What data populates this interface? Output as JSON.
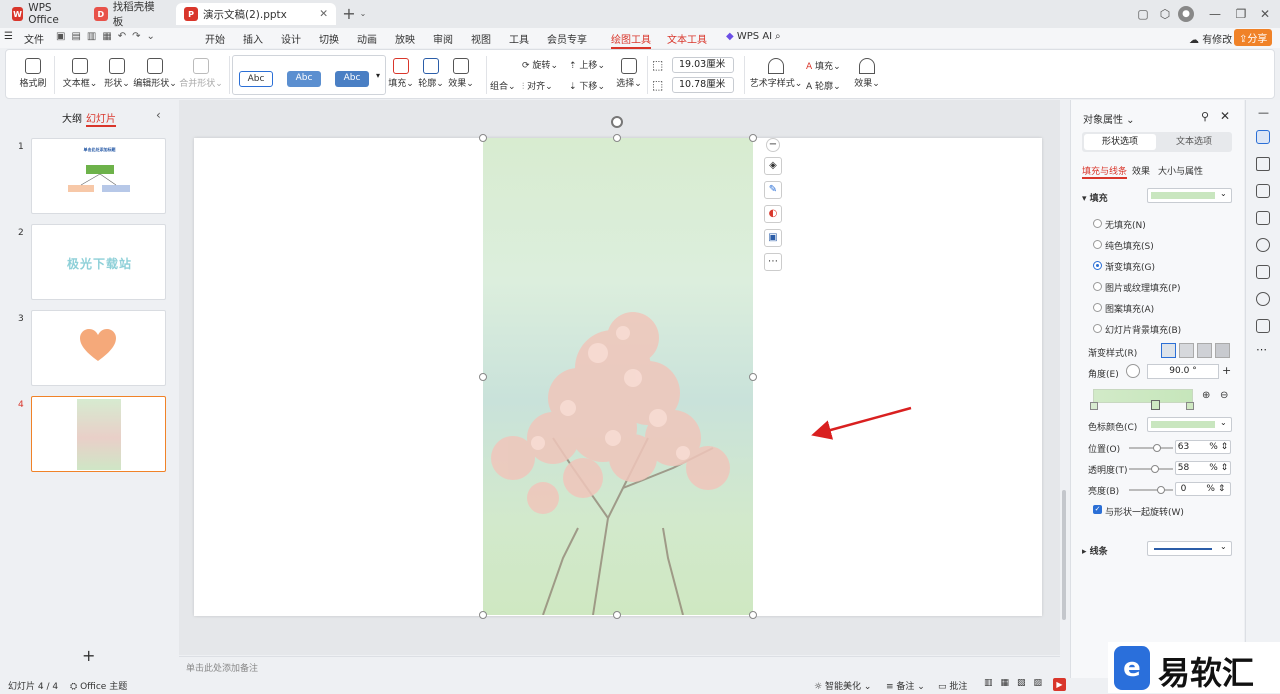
{
  "tabs": [
    {
      "label": "WPS Office",
      "logo": "W"
    },
    {
      "label": "找稻壳模板",
      "logo": "D"
    },
    {
      "label": "演示文稿(2).pptx",
      "logo": "P"
    }
  ],
  "menu": {
    "file": "文件",
    "items": [
      "开始",
      "插入",
      "设计",
      "切换",
      "动画",
      "放映",
      "审阅",
      "视图",
      "工具",
      "会员专享",
      "绘图工具",
      "文本工具",
      "WPS AI"
    ],
    "modified": "有修改",
    "share": "分享"
  },
  "ribbon": {
    "format_brush": "格式刷",
    "textbox": "文本框",
    "shape": "形状",
    "edit_shape": "编辑形状",
    "merge_shape": "合并形状",
    "style_abc": [
      "Abc",
      "Abc",
      "Abc"
    ],
    "fill": "填充",
    "outline": "轮廓",
    "effect": "效果",
    "rotate": "旋转",
    "up": "上移",
    "group": "组合",
    "align": "对齐",
    "down": "下移",
    "select": "选择",
    "height": "19.03厘米",
    "width": "10.78厘米",
    "art_style": "艺术字样式",
    "text_fill": "填充",
    "text_outline": "轮廓",
    "text_effect": "效果"
  },
  "left_panel": {
    "outline_tab": "大纲",
    "slides_tab": "幻灯片",
    "slides": [
      {
        "num": "1",
        "title": "单击此处添加标题"
      },
      {
        "num": "2",
        "text": "极光下载站"
      },
      {
        "num": "3"
      },
      {
        "num": "4"
      }
    ],
    "add": "+"
  },
  "notes_placeholder": "单击此处添加备注",
  "status": {
    "slide_count": "幻灯片 4 / 4",
    "theme": "Office 主题",
    "beautify": "智能美化",
    "notes": "备注",
    "comments": "批注"
  },
  "props": {
    "title": "对象属性",
    "shape_tab": "形状选项",
    "text_tab": "文本选项",
    "sub_fill_line": "填充与线条",
    "sub_effect": "效果",
    "sub_size": "大小与属性",
    "fill_header": "填充",
    "fill_options": [
      "无填充(N)",
      "纯色填充(S)",
      "渐变填充(G)",
      "图片或纹理填充(P)",
      "图案填充(A)",
      "幻灯片背景填充(B)"
    ],
    "gradient_style": "渐变样式(R)",
    "angle_label": "角度(E)",
    "angle_value": "90.0 °",
    "stop_color": "色标颜色(C)",
    "position_label": "位置(O)",
    "position_value": "63",
    "transparency_label": "透明度(T)",
    "transparency_value": "58",
    "brightness_label": "亮度(B)",
    "brightness_value": "0",
    "percent": "%",
    "rotate_with_shape": "与形状一起旋转(W)",
    "line_header": "线条"
  },
  "watermark": "易软汇",
  "colors": {
    "accent": "#d9362b",
    "share": "#f08228",
    "fill_swatch": "#c9e6bf",
    "line_swatch": "#2b5da8"
  }
}
